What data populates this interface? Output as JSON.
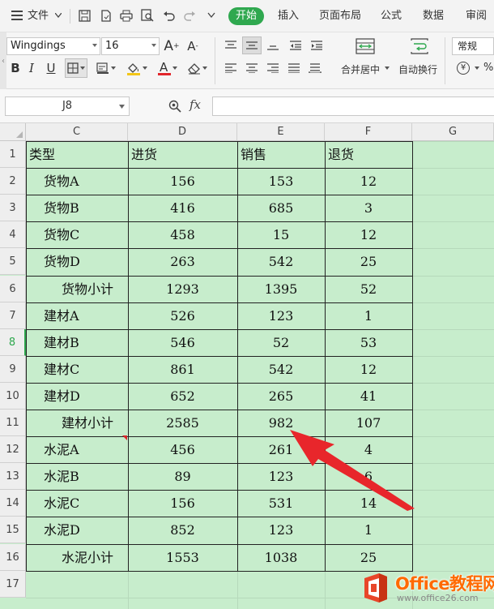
{
  "menubar": {
    "file_label": "文件",
    "tabs": [
      "开始",
      "插入",
      "页面布局",
      "公式",
      "数据",
      "审阅"
    ]
  },
  "ribbon": {
    "font_name": "Wingdings",
    "font_size": "16",
    "merge_center": "合并居中",
    "wrap_text": "自动换行",
    "number_format": "常规",
    "bold": "B",
    "italic": "I",
    "underline": "U",
    "font_color_letter": "A",
    "grow_font": "A",
    "shrink_font": "A",
    "currency_symbol": "¥"
  },
  "formula_bar": {
    "cell_ref": "J8",
    "fx_label": "fx",
    "content": ""
  },
  "columns": [
    "C",
    "D",
    "E",
    "F",
    "G"
  ],
  "rows": [
    "1",
    "2",
    "3",
    "4",
    "5",
    "6",
    "7",
    "8",
    "9",
    "10",
    "11",
    "12",
    "13",
    "14",
    "15",
    "16",
    "17"
  ],
  "active_row": "8",
  "table": {
    "headers": [
      "类型",
      "进货",
      "销售",
      "退货"
    ],
    "rows": [
      [
        "货物A",
        "156",
        "153",
        "12"
      ],
      [
        "货物B",
        "416",
        "685",
        "3"
      ],
      [
        "货物C",
        "458",
        "15",
        "12"
      ],
      [
        "货物D",
        "263",
        "542",
        "25"
      ],
      [
        "货物小计",
        "1293",
        "1395",
        "52"
      ],
      [
        "建材A",
        "526",
        "123",
        "1"
      ],
      [
        "建材B",
        "546",
        "52",
        "53"
      ],
      [
        "建材C",
        "861",
        "542",
        "12"
      ],
      [
        "建材D",
        "652",
        "265",
        "41"
      ],
      [
        "建材小计",
        "2585",
        "982",
        "107"
      ],
      [
        "水泥A",
        "456",
        "261",
        "4"
      ],
      [
        "水泥B",
        "89",
        "123",
        "6"
      ],
      [
        "水泥C",
        "156",
        "531",
        "14"
      ],
      [
        "水泥D",
        "852",
        "123",
        "1"
      ],
      [
        "水泥小计",
        "1553",
        "1038",
        "25"
      ]
    ]
  },
  "watermark": {
    "brand": "Office教程网",
    "url": "www.office26.com"
  },
  "colors": {
    "accent": "#2fa84f",
    "grid_background": "#c7edcc",
    "arrow": "#e8262b",
    "watermark": "#ff6a00"
  }
}
